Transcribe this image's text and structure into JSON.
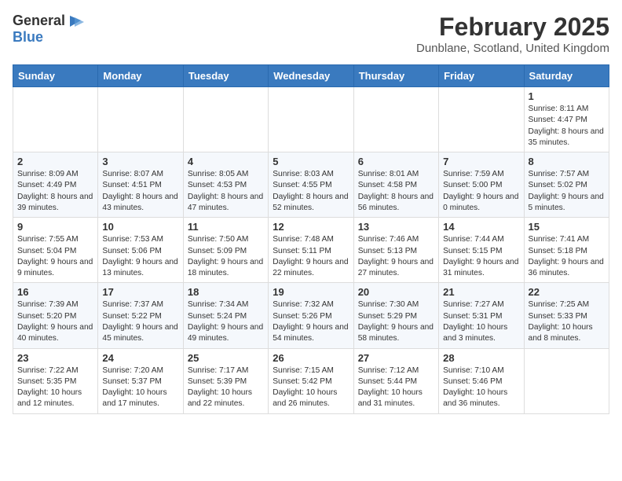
{
  "header": {
    "logo_general": "General",
    "logo_blue": "Blue",
    "month": "February 2025",
    "location": "Dunblane, Scotland, United Kingdom"
  },
  "days_of_week": [
    "Sunday",
    "Monday",
    "Tuesday",
    "Wednesday",
    "Thursday",
    "Friday",
    "Saturday"
  ],
  "weeks": [
    [
      {
        "day": "",
        "info": ""
      },
      {
        "day": "",
        "info": ""
      },
      {
        "day": "",
        "info": ""
      },
      {
        "day": "",
        "info": ""
      },
      {
        "day": "",
        "info": ""
      },
      {
        "day": "",
        "info": ""
      },
      {
        "day": "1",
        "info": "Sunrise: 8:11 AM\nSunset: 4:47 PM\nDaylight: 8 hours and 35 minutes."
      }
    ],
    [
      {
        "day": "2",
        "info": "Sunrise: 8:09 AM\nSunset: 4:49 PM\nDaylight: 8 hours and 39 minutes."
      },
      {
        "day": "3",
        "info": "Sunrise: 8:07 AM\nSunset: 4:51 PM\nDaylight: 8 hours and 43 minutes."
      },
      {
        "day": "4",
        "info": "Sunrise: 8:05 AM\nSunset: 4:53 PM\nDaylight: 8 hours and 47 minutes."
      },
      {
        "day": "5",
        "info": "Sunrise: 8:03 AM\nSunset: 4:55 PM\nDaylight: 8 hours and 52 minutes."
      },
      {
        "day": "6",
        "info": "Sunrise: 8:01 AM\nSunset: 4:58 PM\nDaylight: 8 hours and 56 minutes."
      },
      {
        "day": "7",
        "info": "Sunrise: 7:59 AM\nSunset: 5:00 PM\nDaylight: 9 hours and 0 minutes."
      },
      {
        "day": "8",
        "info": "Sunrise: 7:57 AM\nSunset: 5:02 PM\nDaylight: 9 hours and 5 minutes."
      }
    ],
    [
      {
        "day": "9",
        "info": "Sunrise: 7:55 AM\nSunset: 5:04 PM\nDaylight: 9 hours and 9 minutes."
      },
      {
        "day": "10",
        "info": "Sunrise: 7:53 AM\nSunset: 5:06 PM\nDaylight: 9 hours and 13 minutes."
      },
      {
        "day": "11",
        "info": "Sunrise: 7:50 AM\nSunset: 5:09 PM\nDaylight: 9 hours and 18 minutes."
      },
      {
        "day": "12",
        "info": "Sunrise: 7:48 AM\nSunset: 5:11 PM\nDaylight: 9 hours and 22 minutes."
      },
      {
        "day": "13",
        "info": "Sunrise: 7:46 AM\nSunset: 5:13 PM\nDaylight: 9 hours and 27 minutes."
      },
      {
        "day": "14",
        "info": "Sunrise: 7:44 AM\nSunset: 5:15 PM\nDaylight: 9 hours and 31 minutes."
      },
      {
        "day": "15",
        "info": "Sunrise: 7:41 AM\nSunset: 5:18 PM\nDaylight: 9 hours and 36 minutes."
      }
    ],
    [
      {
        "day": "16",
        "info": "Sunrise: 7:39 AM\nSunset: 5:20 PM\nDaylight: 9 hours and 40 minutes."
      },
      {
        "day": "17",
        "info": "Sunrise: 7:37 AM\nSunset: 5:22 PM\nDaylight: 9 hours and 45 minutes."
      },
      {
        "day": "18",
        "info": "Sunrise: 7:34 AM\nSunset: 5:24 PM\nDaylight: 9 hours and 49 minutes."
      },
      {
        "day": "19",
        "info": "Sunrise: 7:32 AM\nSunset: 5:26 PM\nDaylight: 9 hours and 54 minutes."
      },
      {
        "day": "20",
        "info": "Sunrise: 7:30 AM\nSunset: 5:29 PM\nDaylight: 9 hours and 58 minutes."
      },
      {
        "day": "21",
        "info": "Sunrise: 7:27 AM\nSunset: 5:31 PM\nDaylight: 10 hours and 3 minutes."
      },
      {
        "day": "22",
        "info": "Sunrise: 7:25 AM\nSunset: 5:33 PM\nDaylight: 10 hours and 8 minutes."
      }
    ],
    [
      {
        "day": "23",
        "info": "Sunrise: 7:22 AM\nSunset: 5:35 PM\nDaylight: 10 hours and 12 minutes."
      },
      {
        "day": "24",
        "info": "Sunrise: 7:20 AM\nSunset: 5:37 PM\nDaylight: 10 hours and 17 minutes."
      },
      {
        "day": "25",
        "info": "Sunrise: 7:17 AM\nSunset: 5:39 PM\nDaylight: 10 hours and 22 minutes."
      },
      {
        "day": "26",
        "info": "Sunrise: 7:15 AM\nSunset: 5:42 PM\nDaylight: 10 hours and 26 minutes."
      },
      {
        "day": "27",
        "info": "Sunrise: 7:12 AM\nSunset: 5:44 PM\nDaylight: 10 hours and 31 minutes."
      },
      {
        "day": "28",
        "info": "Sunrise: 7:10 AM\nSunset: 5:46 PM\nDaylight: 10 hours and 36 minutes."
      },
      {
        "day": "",
        "info": ""
      }
    ]
  ]
}
